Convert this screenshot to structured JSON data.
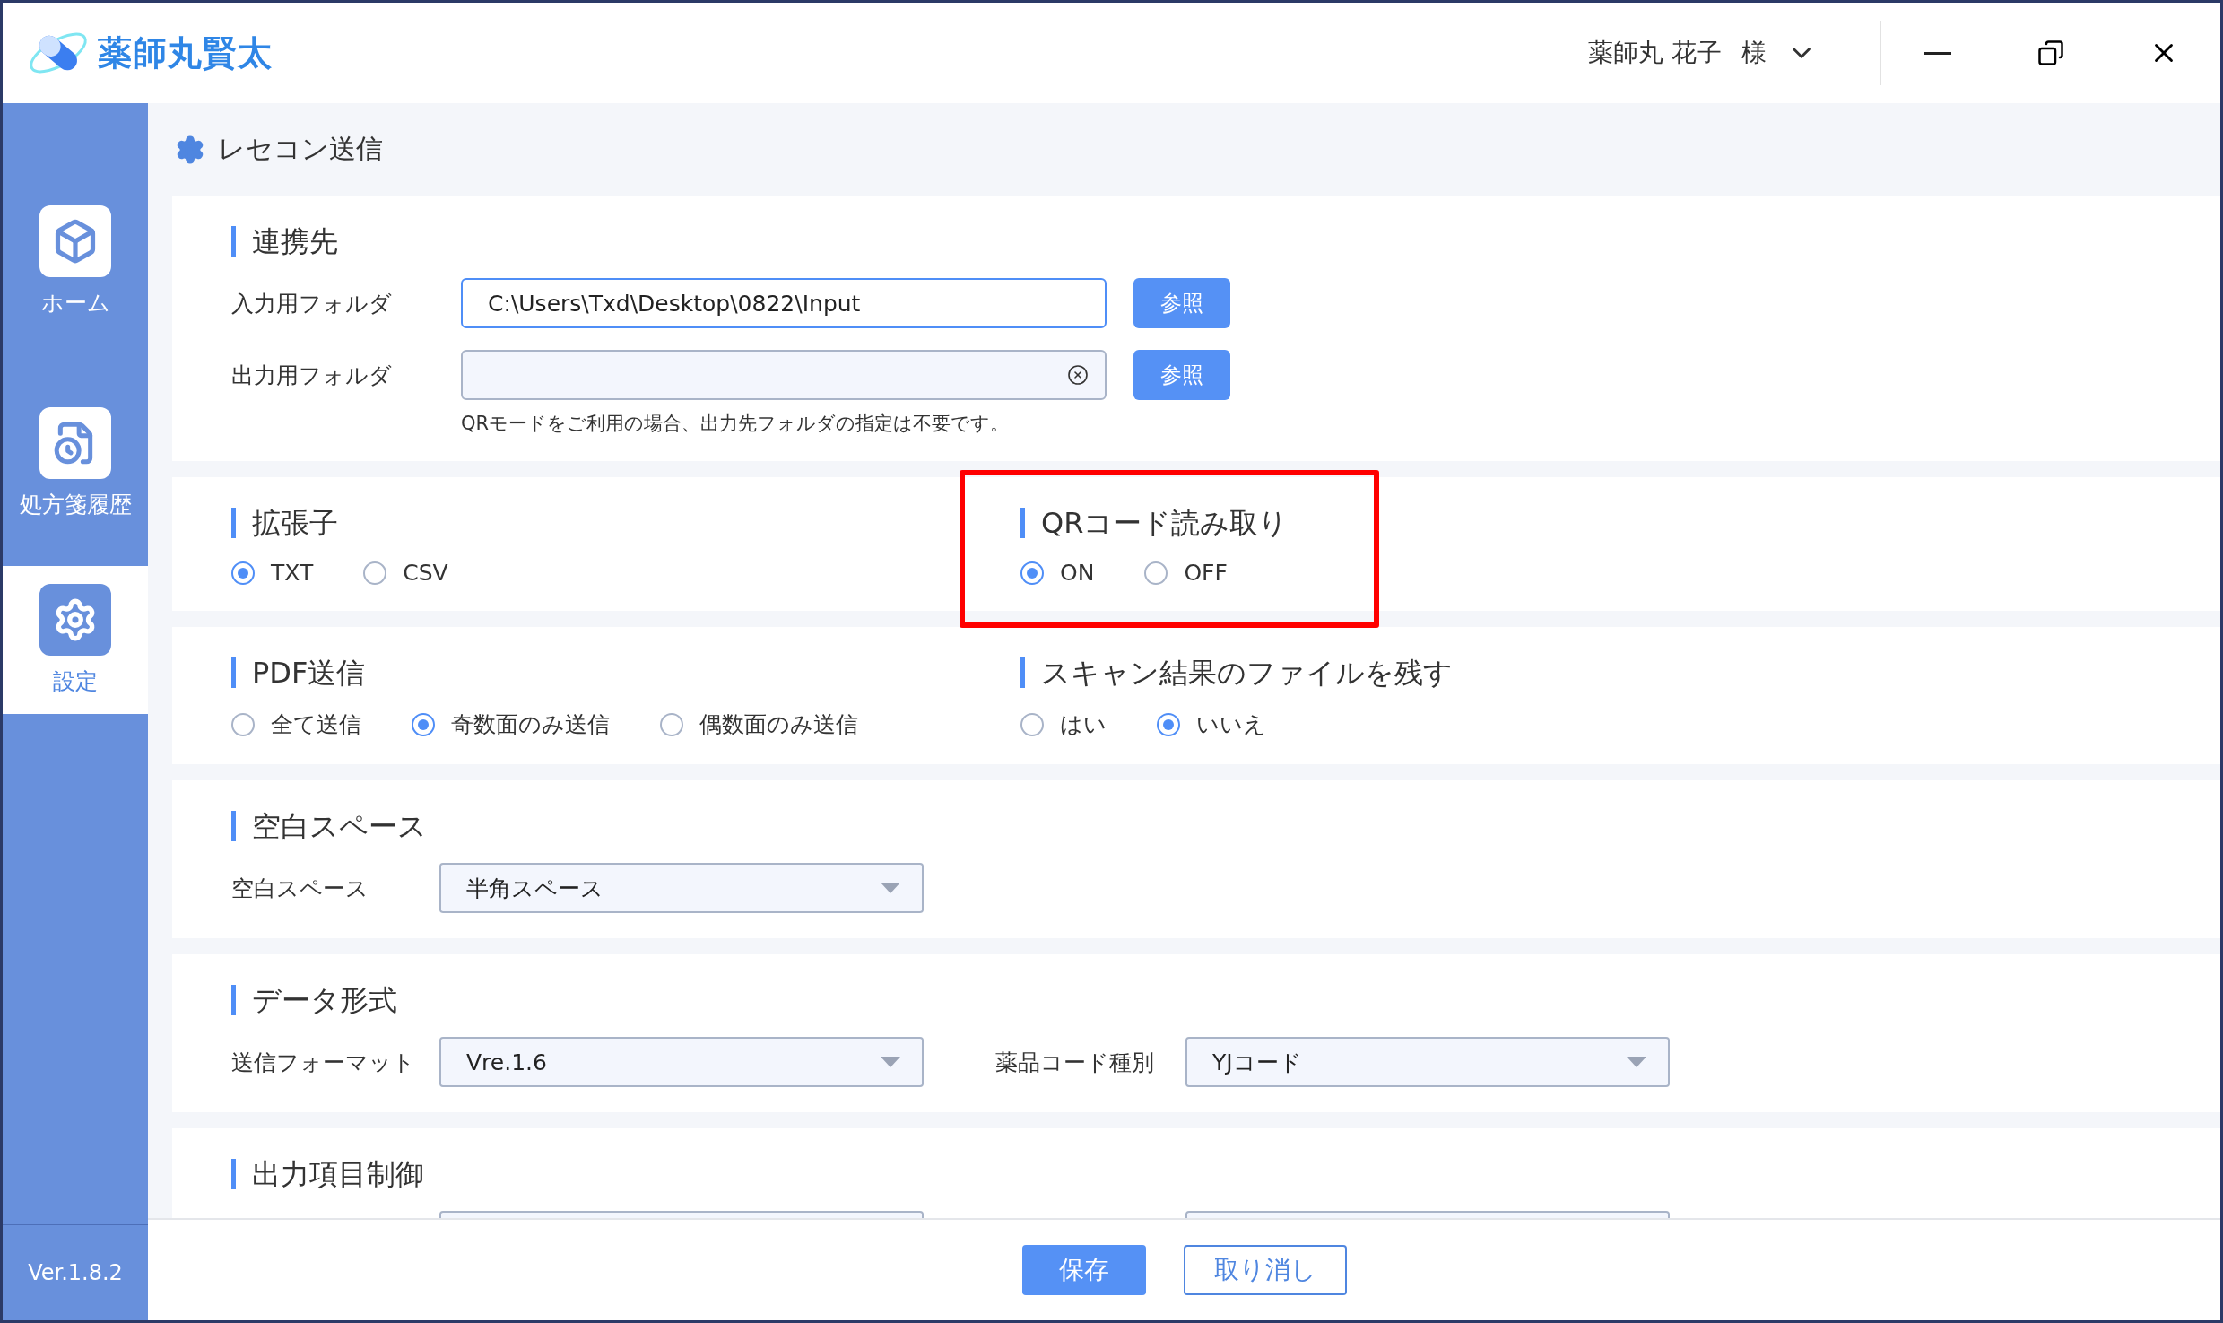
{
  "app": {
    "title": "薬師丸賢太"
  },
  "user": {
    "name": "薬師丸 花子",
    "honorific": "様"
  },
  "sidebar": {
    "items": [
      {
        "label": "ホーム",
        "selected": false
      },
      {
        "label": "処方箋履歴",
        "selected": false
      },
      {
        "label": "設定",
        "selected": true
      }
    ],
    "version": "Ver.1.8.2"
  },
  "page_title": "レセコン送信",
  "cards": [
    {
      "groups": [
        {
          "kind": "folders",
          "title": "連携先",
          "fields": [
            {
              "label": "入力用フォルダ",
              "value": "C:\\Users\\Txd\\Desktop\\0822\\Input",
              "clearable": false,
              "button": "参照"
            },
            {
              "label": "出力用フォルダ",
              "clearable": true,
              "button": "参照"
            }
          ],
          "note": "QRモードをご利用の場合、出力先フォルダの指定は不要です。"
        }
      ]
    },
    {
      "groups": [
        {
          "kind": "radios",
          "title": "拡張子",
          "highlighted": false,
          "options": [
            {
              "label": "TXT",
              "selected": true
            },
            {
              "label": "CSV",
              "selected": false
            }
          ]
        },
        {
          "kind": "radios",
          "title": "QRコード読み取り",
          "highlighted": true,
          "options": [
            {
              "label": "ON",
              "selected": true
            },
            {
              "label": "OFF",
              "selected": false
            }
          ]
        }
      ]
    },
    {
      "groups": [
        {
          "kind": "radios",
          "title": "PDF送信",
          "highlighted": false,
          "options": [
            {
              "label": "全て送信",
              "selected": false
            },
            {
              "label": "奇数面のみ送信",
              "selected": true
            },
            {
              "label": "偶数面のみ送信",
              "selected": false
            }
          ]
        },
        {
          "kind": "radios",
          "title": "スキャン結果のファイルを残す",
          "highlighted": false,
          "options": [
            {
              "label": "はい",
              "selected": false
            },
            {
              "label": "いいえ",
              "selected": true
            }
          ]
        }
      ]
    },
    {
      "groups": [
        {
          "kind": "selects",
          "title": "空白スペース",
          "fields": [
            {
              "label": "空白スペース",
              "value": "半角スペース"
            }
          ]
        }
      ]
    },
    {
      "groups": [
        {
          "kind": "selects",
          "title": "データ形式",
          "fields": [
            {
              "label": "送信フォーマット",
              "value": "Vre.1.6"
            },
            {
              "label": "薬品コード種別",
              "value": "YJコード"
            }
          ]
        }
      ]
    },
    {
      "groups": [
        {
          "kind": "selects",
          "title": "出力項目制御",
          "fields": [
            {
              "partial": true
            },
            {
              "partial": true
            }
          ]
        }
      ]
    }
  ],
  "footer": {
    "buttons": [
      {
        "label": "保存",
        "kind": "primary"
      },
      {
        "label": "取り消し",
        "kind": "secondary"
      }
    ]
  }
}
